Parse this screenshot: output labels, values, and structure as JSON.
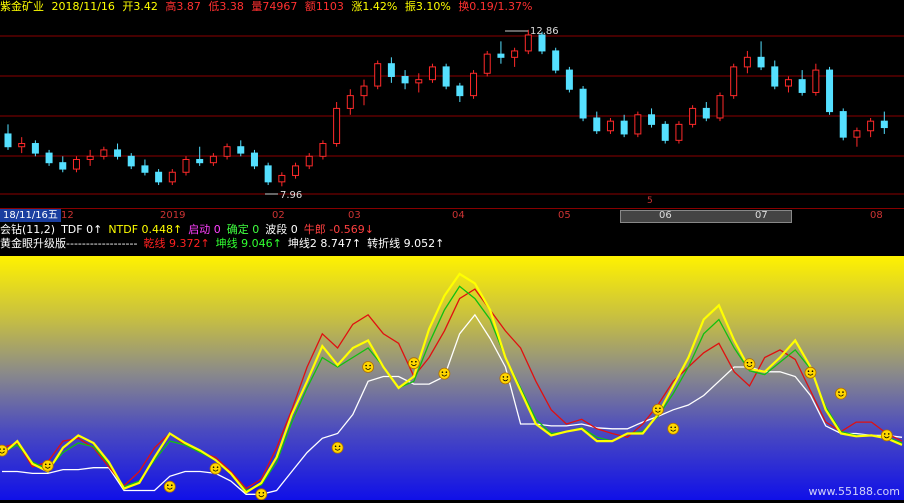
{
  "info_bar": {
    "title": "紫金矿业",
    "date": "2018/11/16",
    "open": "开3.42",
    "high": "高3.87",
    "low": "低3.38",
    "volume": "量74967",
    "amount": "额1103",
    "change": "涨1.42%",
    "amplitude": "振3.10%",
    "turnover": "换0.19/1.37%"
  },
  "colors": {
    "up": "#ff2a2a",
    "down": "#55e0ff",
    "grid": "#8b0000",
    "info": "#ffff00",
    "red_line": "#e01010",
    "yellow_line": "#ffff00",
    "green_line": "#10c010",
    "white_line": "#ffffff"
  },
  "price_labels": {
    "high": "12.86",
    "low": "7.96"
  },
  "time_axis": {
    "date_box": "18/11/16五",
    "ticks": [
      "12",
      "2019",
      "02",
      "03",
      "04",
      "05",
      "06",
      "07",
      "08"
    ],
    "marker": "5"
  },
  "indicator_row1": [
    {
      "text": "会钻(11,2)",
      "color": "#ffffff"
    },
    {
      "text": "TDF 0↑",
      "color": "#ffffff"
    },
    {
      "text": "NTDF 0.448↑",
      "color": "#ffff00"
    },
    {
      "text": "启动 0",
      "color": "#ff40ff"
    },
    {
      "text": "确定 0",
      "color": "#40ff40"
    },
    {
      "text": "波段 0",
      "color": "#ffffff"
    },
    {
      "text": "牛郎 -0.569↓",
      "color": "#ff4040"
    }
  ],
  "indicator_row2": [
    {
      "text": "黄金眼升级版------------------",
      "color": "#ffffff"
    },
    {
      "text": "乾线 9.372↑",
      "color": "#ff2020"
    },
    {
      "text": "坤线 9.046↑",
      "color": "#30ff30"
    },
    {
      "text": "坤线2 8.747↑",
      "color": "#ffffff"
    },
    {
      "text": "转折线 9.052↑",
      "color": "#ffffff"
    }
  ],
  "watermark": "www.55188.com",
  "chart_data": {
    "type": "line",
    "title": "",
    "ylim": [
      7.5,
      13.2
    ],
    "candles": [
      [
        9.6,
        9.9,
        9.1,
        9.2
      ],
      [
        9.2,
        9.5,
        9.0,
        9.3
      ],
      [
        9.3,
        9.4,
        8.9,
        9.0
      ],
      [
        9.0,
        9.1,
        8.6,
        8.7
      ],
      [
        8.7,
        8.9,
        8.4,
        8.5
      ],
      [
        8.5,
        8.9,
        8.4,
        8.8
      ],
      [
        8.8,
        9.1,
        8.6,
        8.9
      ],
      [
        8.9,
        9.2,
        8.8,
        9.1
      ],
      [
        9.1,
        9.3,
        8.8,
        8.9
      ],
      [
        8.9,
        9.0,
        8.5,
        8.6
      ],
      [
        8.6,
        8.8,
        8.3,
        8.4
      ],
      [
        8.4,
        8.5,
        8.0,
        8.1
      ],
      [
        8.1,
        8.5,
        8.0,
        8.4
      ],
      [
        8.4,
        8.9,
        8.3,
        8.8
      ],
      [
        8.8,
        9.2,
        8.6,
        8.7
      ],
      [
        8.7,
        9.0,
        8.6,
        8.9
      ],
      [
        8.9,
        9.3,
        8.8,
        9.2
      ],
      [
        9.2,
        9.4,
        8.9,
        9.0
      ],
      [
        9.0,
        9.1,
        8.5,
        8.6
      ],
      [
        8.6,
        8.7,
        8.0,
        8.1
      ],
      [
        8.1,
        8.4,
        7.96,
        8.3
      ],
      [
        8.3,
        8.7,
        8.2,
        8.6
      ],
      [
        8.6,
        9.0,
        8.5,
        8.9
      ],
      [
        8.9,
        9.4,
        8.8,
        9.3
      ],
      [
        9.3,
        10.6,
        9.2,
        10.4
      ],
      [
        10.4,
        11.0,
        10.2,
        10.8
      ],
      [
        10.8,
        11.3,
        10.5,
        11.1
      ],
      [
        11.1,
        11.9,
        11.0,
        11.8
      ],
      [
        11.8,
        12.0,
        11.2,
        11.4
      ],
      [
        11.4,
        11.6,
        11.0,
        11.2
      ],
      [
        11.2,
        11.5,
        10.9,
        11.3
      ],
      [
        11.3,
        11.8,
        11.2,
        11.7
      ],
      [
        11.7,
        11.8,
        11.0,
        11.1
      ],
      [
        11.1,
        11.2,
        10.6,
        10.8
      ],
      [
        10.8,
        11.6,
        10.7,
        11.5
      ],
      [
        11.5,
        12.2,
        11.4,
        12.1
      ],
      [
        12.1,
        12.5,
        11.8,
        12.0
      ],
      [
        12.0,
        12.3,
        11.7,
        12.2
      ],
      [
        12.2,
        12.86,
        12.1,
        12.7
      ],
      [
        12.7,
        12.8,
        12.1,
        12.2
      ],
      [
        12.2,
        12.3,
        11.5,
        11.6
      ],
      [
        11.6,
        11.7,
        10.9,
        11.0
      ],
      [
        11.0,
        11.1,
        10.0,
        10.1
      ],
      [
        10.1,
        10.3,
        9.6,
        9.7
      ],
      [
        9.7,
        10.1,
        9.6,
        10.0
      ],
      [
        10.0,
        10.2,
        9.5,
        9.6
      ],
      [
        9.6,
        10.3,
        9.5,
        10.2
      ],
      [
        10.2,
        10.4,
        9.8,
        9.9
      ],
      [
        9.9,
        10.0,
        9.3,
        9.4
      ],
      [
        9.4,
        10.0,
        9.3,
        9.9
      ],
      [
        9.9,
        10.5,
        9.8,
        10.4
      ],
      [
        10.4,
        10.6,
        10.0,
        10.1
      ],
      [
        10.1,
        10.9,
        10.0,
        10.8
      ],
      [
        10.8,
        11.8,
        10.7,
        11.7
      ],
      [
        11.7,
        12.2,
        11.5,
        12.0
      ],
      [
        12.0,
        12.5,
        11.6,
        11.7
      ],
      [
        11.7,
        11.9,
        11.0,
        11.1
      ],
      [
        11.1,
        11.4,
        10.9,
        11.3
      ],
      [
        11.3,
        11.6,
        10.8,
        10.9
      ],
      [
        10.9,
        11.8,
        10.8,
        11.6
      ],
      [
        11.6,
        11.7,
        10.2,
        10.3
      ],
      [
        10.3,
        10.4,
        9.4,
        9.5
      ],
      [
        9.5,
        9.8,
        9.2,
        9.7
      ],
      [
        9.7,
        10.1,
        9.5,
        10.0
      ],
      [
        10.0,
        10.3,
        9.6,
        9.8
      ]
    ],
    "series": [
      {
        "color": "red",
        "values": [
          55,
          60,
          35,
          40,
          62,
          65,
          55,
          35,
          15,
          30,
          55,
          70,
          58,
          50,
          45,
          30,
          12,
          22,
          55,
          95,
          140,
          175,
          160,
          185,
          195,
          175,
          165,
          130,
          150,
          178,
          212,
          222,
          200,
          178,
          160,
          125,
          95,
          80,
          85,
          75,
          70,
          66,
          80,
          100,
          125,
          140,
          155,
          165,
          135,
          120,
          150,
          158,
          148,
          115,
          82,
          72,
          82,
          82,
          70,
          62
        ]
      },
      {
        "color": "yellow",
        "values": [
          48,
          62,
          38,
          30,
          55,
          68,
          60,
          40,
          12,
          18,
          45,
          70,
          60,
          52,
          42,
          28,
          8,
          18,
          45,
          90,
          125,
          162,
          142,
          160,
          168,
          140,
          118,
          130,
          180,
          215,
          238,
          228,
          200,
          150,
          115,
          80,
          68,
          72,
          75,
          62,
          62,
          70,
          70,
          90,
          120,
          150,
          190,
          205,
          168,
          138,
          135,
          150,
          168,
          140,
          95,
          70,
          67,
          68,
          65,
          58
        ]
      },
      {
        "color": "green",
        "values": [
          50,
          58,
          40,
          32,
          50,
          60,
          56,
          38,
          14,
          20,
          42,
          62,
          58,
          50,
          42,
          28,
          10,
          16,
          40,
          82,
          118,
          150,
          140,
          150,
          160,
          140,
          118,
          125,
          165,
          200,
          225,
          212,
          190,
          150,
          118,
          85,
          70,
          72,
          76,
          66,
          62,
          70,
          72,
          88,
          112,
          140,
          175,
          190,
          160,
          136,
          132,
          145,
          158,
          138,
          98,
          72,
          68,
          68,
          66,
          60
        ]
      },
      {
        "color": "white",
        "values": [
          30,
          30,
          28,
          28,
          32,
          32,
          34,
          34,
          10,
          10,
          10,
          25,
          30,
          30,
          28,
          20,
          6,
          6,
          10,
          30,
          50,
          65,
          70,
          90,
          125,
          130,
          130,
          122,
          122,
          130,
          175,
          195,
          170,
          140,
          80,
          80,
          78,
          78,
          80,
          76,
          75,
          75,
          82,
          88,
          95,
          100,
          110,
          125,
          140,
          140,
          135,
          135,
          130,
          110,
          78,
          70,
          70,
          68,
          68,
          66
        ]
      }
    ],
    "smiley_points": [
      [
        0,
        52
      ],
      [
        3,
        36
      ],
      [
        11,
        14
      ],
      [
        17,
        6
      ],
      [
        14,
        33
      ],
      [
        22,
        55
      ],
      [
        24,
        140
      ],
      [
        27,
        144
      ],
      [
        29,
        133
      ],
      [
        33,
        128
      ],
      [
        43,
        95
      ],
      [
        44,
        75
      ],
      [
        49,
        143
      ],
      [
        53,
        134
      ],
      [
        55,
        112
      ],
      [
        58,
        68
      ],
      [
        64,
        68
      ],
      [
        65,
        62
      ]
    ]
  }
}
